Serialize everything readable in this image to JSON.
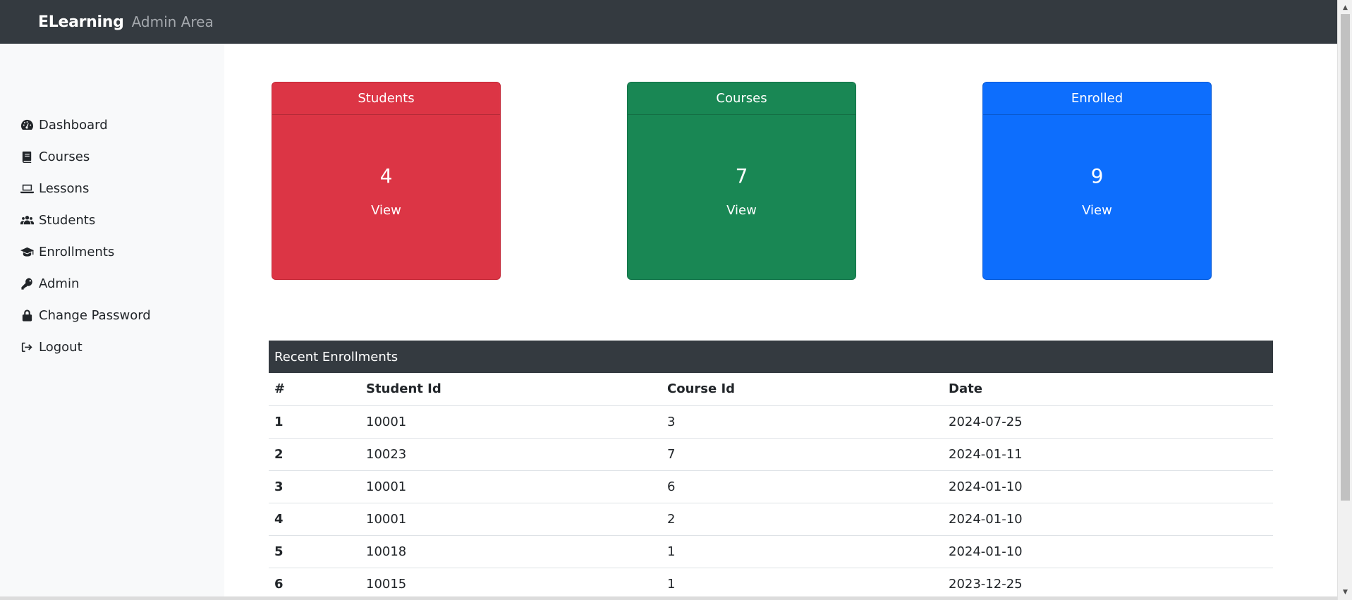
{
  "header": {
    "brand": "ELearning",
    "subtitle": "Admin Area"
  },
  "sidebar": {
    "items": [
      {
        "label": "Dashboard",
        "icon": "tachometer-icon"
      },
      {
        "label": "Courses",
        "icon": "book-icon"
      },
      {
        "label": "Lessons",
        "icon": "laptop-icon"
      },
      {
        "label": "Students",
        "icon": "users-icon"
      },
      {
        "label": "Enrollments",
        "icon": "graduation-cap-icon"
      },
      {
        "label": "Admin",
        "icon": "key-icon"
      },
      {
        "label": "Change Password",
        "icon": "lock-icon"
      },
      {
        "label": "Logout",
        "icon": "sign-out-icon"
      }
    ]
  },
  "cards": [
    {
      "title": "Students",
      "count": "4",
      "link": "View",
      "color": "#dc3545"
    },
    {
      "title": "Courses",
      "count": "7",
      "link": "View",
      "color": "#198754"
    },
    {
      "title": "Enrolled",
      "count": "9",
      "link": "View",
      "color": "#0d6efd"
    }
  ],
  "enrollments": {
    "title": "Recent Enrollments",
    "columns": [
      "#",
      "Student Id",
      "Course Id",
      "Date"
    ],
    "rows": [
      [
        "1",
        "10001",
        "3",
        "2024-07-25"
      ],
      [
        "2",
        "10023",
        "7",
        "2024-01-11"
      ],
      [
        "3",
        "10001",
        "6",
        "2024-01-10"
      ],
      [
        "4",
        "10001",
        "2",
        "2024-01-10"
      ],
      [
        "5",
        "10018",
        "1",
        "2024-01-10"
      ],
      [
        "6",
        "10015",
        "1",
        "2023-12-25"
      ]
    ]
  }
}
